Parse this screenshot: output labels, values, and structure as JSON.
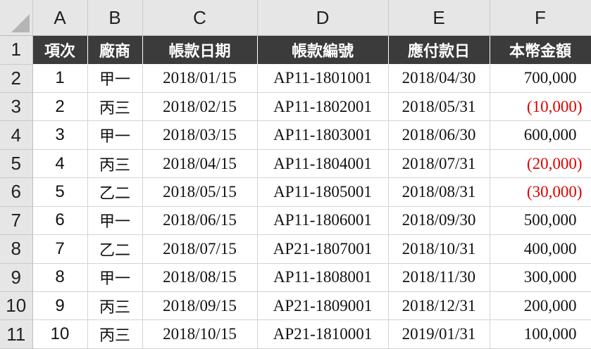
{
  "columns": [
    "A",
    "B",
    "C",
    "D",
    "E",
    "F"
  ],
  "header": [
    "項次",
    "廠商",
    "帳款日期",
    "帳款編號",
    "應付款日",
    "本幣金額"
  ],
  "rows": [
    {
      "row": "2",
      "item": "1",
      "vendor": "甲一",
      "date": "2018/01/15",
      "id": "AP11-1801001",
      "due": "2018/04/30",
      "amount": "700,000",
      "negative": false
    },
    {
      "row": "3",
      "item": "2",
      "vendor": "丙三",
      "date": "2018/02/15",
      "id": "AP11-1802001",
      "due": "2018/05/31",
      "amount": "(10,000)",
      "negative": true
    },
    {
      "row": "4",
      "item": "3",
      "vendor": "甲一",
      "date": "2018/03/15",
      "id": "AP11-1803001",
      "due": "2018/06/30",
      "amount": "600,000",
      "negative": false
    },
    {
      "row": "5",
      "item": "4",
      "vendor": "丙三",
      "date": "2018/04/15",
      "id": "AP11-1804001",
      "due": "2018/07/31",
      "amount": "(20,000)",
      "negative": true
    },
    {
      "row": "6",
      "item": "5",
      "vendor": "乙二",
      "date": "2018/05/15",
      "id": "AP11-1805001",
      "due": "2018/08/31",
      "amount": "(30,000)",
      "negative": true
    },
    {
      "row": "7",
      "item": "6",
      "vendor": "甲一",
      "date": "2018/06/15",
      "id": "AP11-1806001",
      "due": "2018/09/30",
      "amount": "500,000",
      "negative": false
    },
    {
      "row": "8",
      "item": "7",
      "vendor": "乙二",
      "date": "2018/07/15",
      "id": "AP21-1807001",
      "due": "2018/10/31",
      "amount": "400,000",
      "negative": false
    },
    {
      "row": "9",
      "item": "8",
      "vendor": "甲一",
      "date": "2018/08/15",
      "id": "AP11-1808001",
      "due": "2018/11/30",
      "amount": "300,000",
      "negative": false
    },
    {
      "row": "10",
      "item": "9",
      "vendor": "丙三",
      "date": "2018/09/15",
      "id": "AP21-1809001",
      "due": "2018/12/31",
      "amount": "200,000",
      "negative": false
    },
    {
      "row": "11",
      "item": "10",
      "vendor": "丙三",
      "date": "2018/10/15",
      "id": "AP21-1810001",
      "due": "2019/01/31",
      "amount": "100,000",
      "negative": false
    }
  ],
  "header_row_number": "1",
  "colors": {
    "header_bg": "#3b3b3b",
    "negative": "#e00000",
    "grid_header": "#e6e6e6"
  }
}
